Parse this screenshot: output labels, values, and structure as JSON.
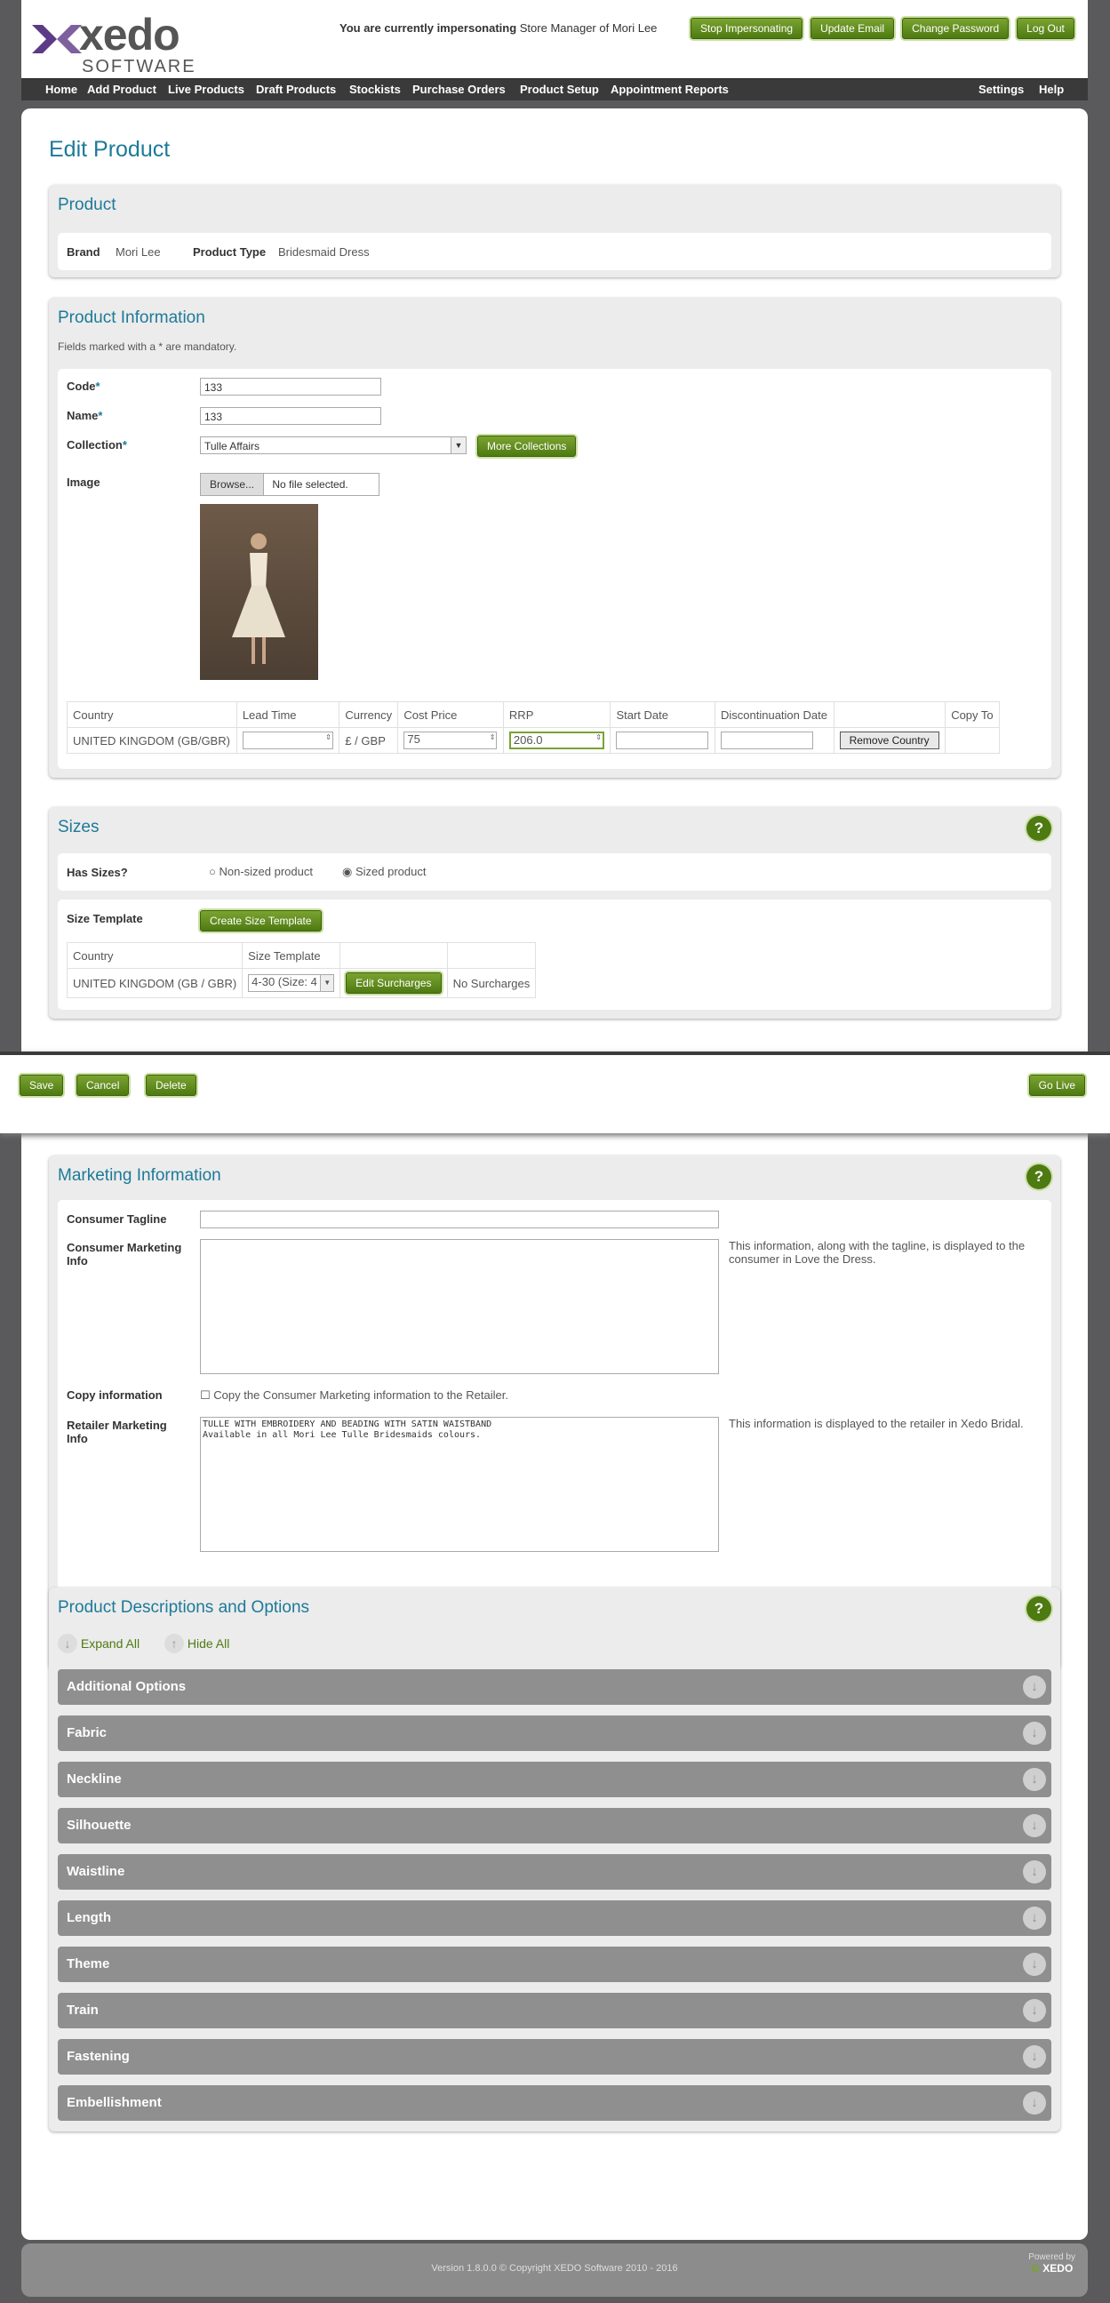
{
  "header": {
    "logo_text": "xedo",
    "logo_sub": "SOFTWARE",
    "impersonating_prefix": "You are currently impersonating",
    "impersonating_name": "Store Manager of Mori Lee",
    "buttons": {
      "stop": "Stop Impersonating",
      "email": "Update Email",
      "password": "Change Password",
      "logout": "Log Out"
    }
  },
  "nav": {
    "home": "Home",
    "add": "Add Product",
    "live": "Live Products",
    "draft": "Draft Products",
    "stockists": "Stockists",
    "po": "Purchase Orders",
    "setup": "Product Setup",
    "appt": "Appointment Reports",
    "settings": "Settings",
    "help": "Help"
  },
  "page_title": "Edit Product",
  "product": {
    "heading": "Product",
    "brand_label": "Brand",
    "brand": "Mori Lee",
    "type_label": "Product Type",
    "type": "Bridesmaid Dress"
  },
  "info": {
    "heading": "Product Information",
    "mandatory_note": "Fields marked with a * are mandatory.",
    "code_label": "Code",
    "code": "133",
    "name_label": "Name",
    "name": "133",
    "collection_label": "Collection",
    "collection": "Tulle Affairs",
    "more_collections": "More Collections",
    "image_label": "Image",
    "browse": "Browse...",
    "no_file": "No file selected.",
    "price_headers": [
      "Country",
      "Lead Time",
      "Currency",
      "Cost Price",
      "RRP",
      "Start Date",
      "Discontinuation Date",
      "",
      "Copy To"
    ],
    "price_row": {
      "country": "UNITED KINGDOM (GB/GBR)",
      "lead_time": "",
      "currency": "£ / GBP",
      "cost": "75",
      "rrp": "206.0",
      "start": "",
      "disc": "",
      "remove": "Remove Country"
    }
  },
  "sizes": {
    "heading": "Sizes",
    "has_sizes_label": "Has Sizes?",
    "opt_non": "Non-sized product",
    "opt_sized": "Sized product",
    "template_label": "Size Template",
    "create_template": "Create Size Template",
    "col_country": "Country",
    "col_template": "Size Template",
    "country": "UNITED KINGDOM (GB / GBR)",
    "template": "4-30 (Size: 4",
    "edit_surcharges": "Edit Surcharges",
    "no_surcharges": "No Surcharges"
  },
  "actions": {
    "save": "Save",
    "cancel": "Cancel",
    "delete": "Delete",
    "go_live": "Go Live"
  },
  "marketing": {
    "heading": "Marketing Information",
    "tagline_label": "Consumer Tagline",
    "consumer_label": "Consumer Marketing Info",
    "consumer_note": "This information, along with the tagline, is displayed to the consumer in Love the Dress.",
    "copy_label": "Copy information",
    "copy_text": "Copy the Consumer Marketing information to the Retailer.",
    "retailer_label": "Retailer Marketing Info",
    "retailer_text": "TULLE WITH EMBROIDERY AND BEADING WITH SATIN WAISTBAND\nAvailable in all Mori Lee Tulle Bridesmaids colours.",
    "retailer_note": "This information is displayed to the retailer in Xedo Bridal."
  },
  "descriptions": {
    "heading": "Product Descriptions and Options",
    "expand": "Expand All",
    "hide": "Hide All",
    "items": [
      "Additional Options",
      "Fabric",
      "Neckline",
      "Silhouette",
      "Waistline",
      "Length",
      "Theme",
      "Train",
      "Fastening",
      "Embellishment"
    ]
  },
  "footer": {
    "version": "Version 1.8.0.0   © Copyright XEDO Software 2010 - 2016",
    "powered": "Powered by",
    "brand": "XEDO"
  },
  "colors": {
    "accent": "#1d7a99",
    "button_green": "#5e8a1c",
    "nav_bg": "#3a3a3a",
    "accordion": "#8f8f8f"
  },
  "icons": [
    "help-icon",
    "chevron-down-icon",
    "dropdown-arrow-icon",
    "spin-icon"
  ]
}
